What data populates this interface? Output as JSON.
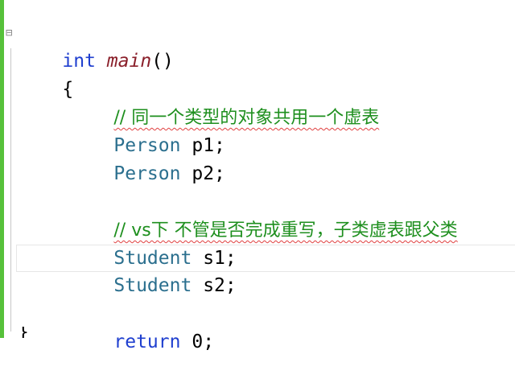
{
  "colors": {
    "keyword": "#1f3fcf",
    "function": "#8a1f2a",
    "type": "#2b6f8e",
    "comment": "#1e8f1e",
    "change_margin": "#56c13a",
    "squiggle": "#e04040"
  },
  "code": {
    "line1": {
      "kw": "int",
      "fn": "main",
      "rest": "()"
    },
    "line2": {
      "text": "{"
    },
    "line3": {
      "comment": "// 同一个类型的对象共用一个虚表"
    },
    "line4": {
      "type": "Person",
      "var": "p1;"
    },
    "line5": {
      "type": "Person",
      "var": "p2;"
    },
    "line6": {
      "comment": "// vs下 不管是否完成重写，子类虚表跟父类"
    },
    "line7": {
      "type": "Student",
      "var": "s1;"
    },
    "line8": {
      "type": "Student",
      "var": "s2;"
    },
    "line9": {
      "kw": "return",
      "num": "0;"
    },
    "line10": {
      "text": "}"
    }
  }
}
